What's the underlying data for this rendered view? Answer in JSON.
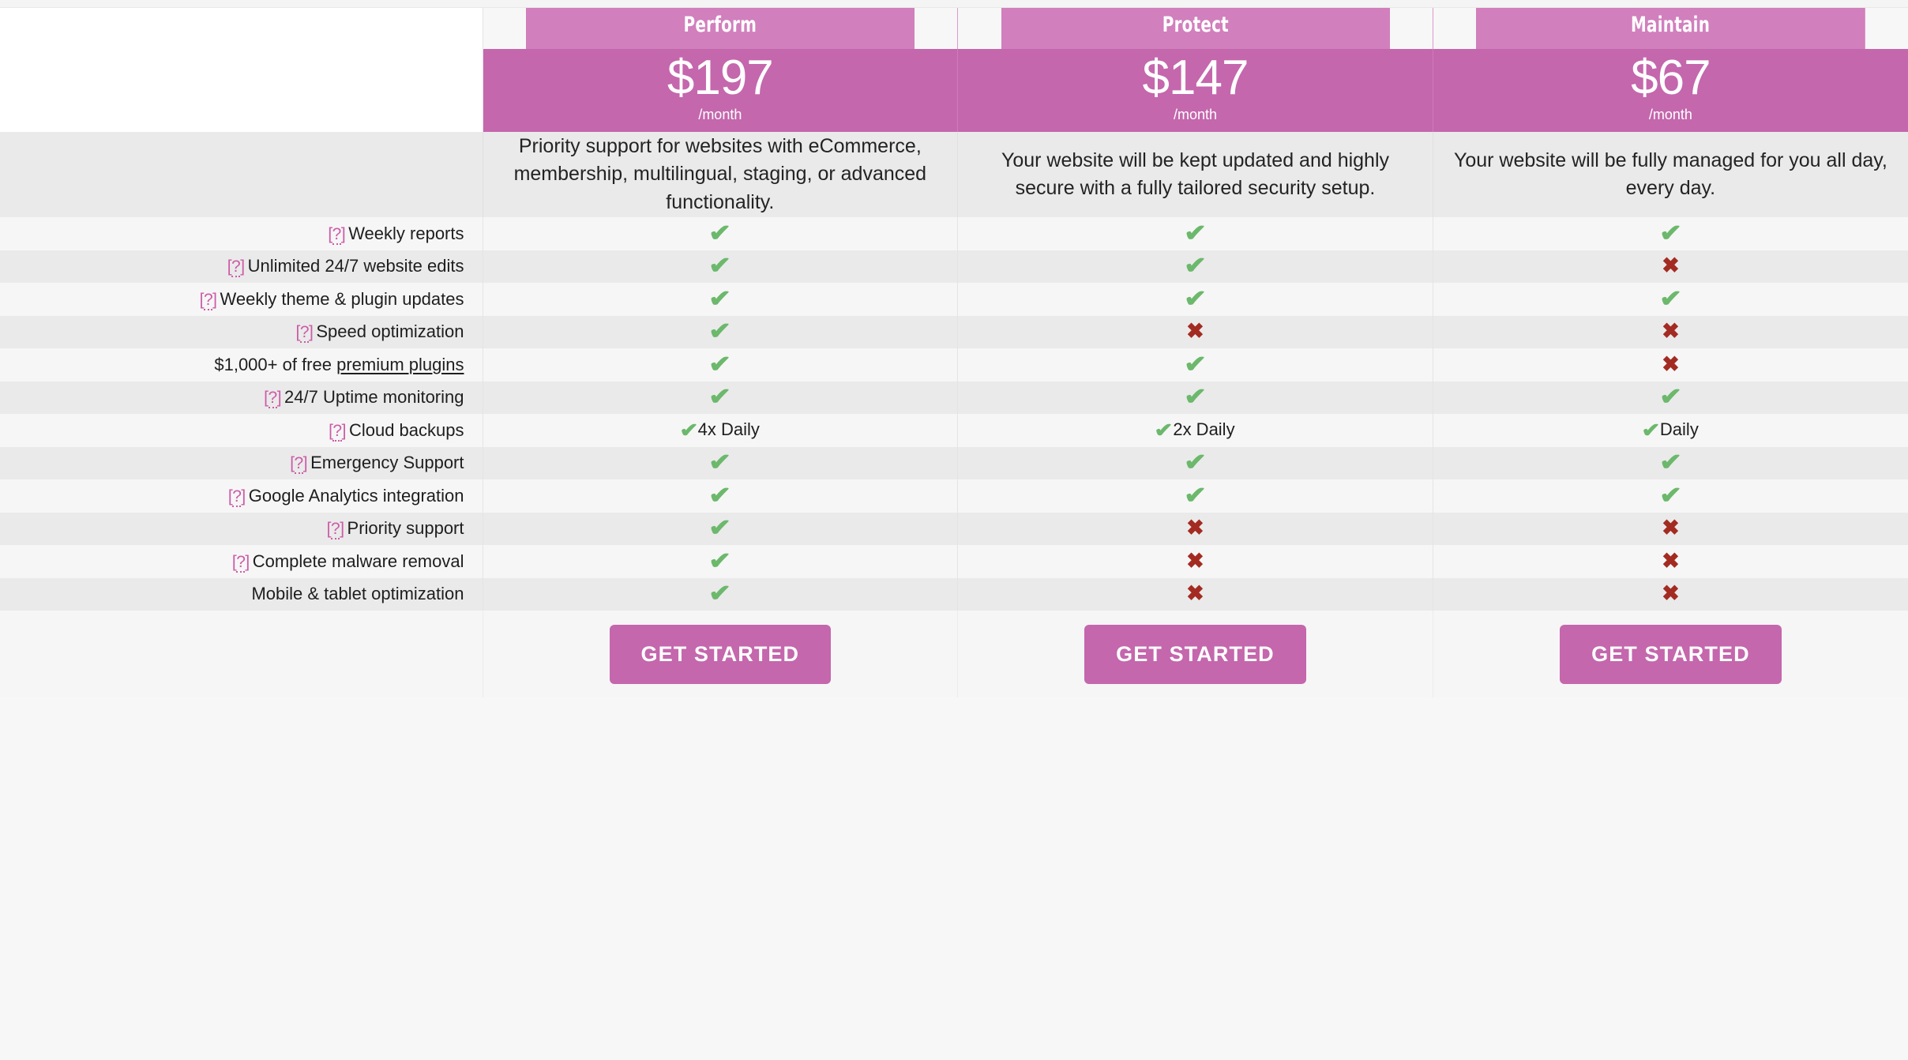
{
  "plans": [
    {
      "name": "Perform",
      "price": "$197",
      "period": "/month",
      "description": "Priority support for websites with eCommerce, membership, multilingual, staging, or advanced functionality.",
      "cta_label": "GET STARTED"
    },
    {
      "name": "Protect",
      "price": "$147",
      "period": "/month",
      "description": "Your website will be kept updated and highly secure with a fully tailored security setup.",
      "cta_label": "GET STARTED"
    },
    {
      "name": "Maintain",
      "price": "$67",
      "period": "/month",
      "description": "Your website will be fully managed for you all day, every day.",
      "cta_label": "GET STARTED"
    }
  ],
  "tooltip_glyph": "[?]",
  "check_glyph": "✔",
  "cross_glyph": "✖",
  "features": [
    {
      "label": "Weekly reports",
      "has_tooltip": true,
      "values": [
        {
          "type": "check"
        },
        {
          "type": "check"
        },
        {
          "type": "check"
        }
      ]
    },
    {
      "label": "Unlimited 24/7 website edits",
      "has_tooltip": true,
      "values": [
        {
          "type": "check"
        },
        {
          "type": "check"
        },
        {
          "type": "cross"
        }
      ]
    },
    {
      "label": "Weekly theme & plugin updates",
      "has_tooltip": true,
      "values": [
        {
          "type": "check"
        },
        {
          "type": "check"
        },
        {
          "type": "check"
        }
      ]
    },
    {
      "label": "Speed optimization",
      "has_tooltip": true,
      "values": [
        {
          "type": "check"
        },
        {
          "type": "cross"
        },
        {
          "type": "cross"
        }
      ]
    },
    {
      "label": "$1,000+ of free premium plugins",
      "has_tooltip": false,
      "link_text": "premium plugins",
      "prefix_text": "$1,000+ of free ",
      "values": [
        {
          "type": "check"
        },
        {
          "type": "check"
        },
        {
          "type": "cross"
        }
      ]
    },
    {
      "label": "24/7 Uptime monitoring",
      "has_tooltip": true,
      "values": [
        {
          "type": "check"
        },
        {
          "type": "check"
        },
        {
          "type": "check"
        }
      ]
    },
    {
      "label": "Cloud backups",
      "has_tooltip": true,
      "values": [
        {
          "type": "check_text",
          "text": "4x Daily"
        },
        {
          "type": "check_text",
          "text": "2x Daily"
        },
        {
          "type": "check_text",
          "text": "Daily"
        }
      ]
    },
    {
      "label": "Emergency Support",
      "has_tooltip": true,
      "values": [
        {
          "type": "check"
        },
        {
          "type": "check"
        },
        {
          "type": "check"
        }
      ]
    },
    {
      "label": "Google Analytics integration",
      "has_tooltip": true,
      "values": [
        {
          "type": "check"
        },
        {
          "type": "check"
        },
        {
          "type": "check"
        }
      ]
    },
    {
      "label": "Priority support",
      "has_tooltip": true,
      "values": [
        {
          "type": "check"
        },
        {
          "type": "cross"
        },
        {
          "type": "cross"
        }
      ]
    },
    {
      "label": "Complete malware removal",
      "has_tooltip": true,
      "values": [
        {
          "type": "check"
        },
        {
          "type": "cross"
        },
        {
          "type": "cross"
        }
      ]
    },
    {
      "label": "Mobile & tablet optimization",
      "has_tooltip": false,
      "values": [
        {
          "type": "check"
        },
        {
          "type": "cross"
        },
        {
          "type": "cross"
        }
      ]
    }
  ],
  "colors": {
    "plan_header": "#d17fbd",
    "price_header": "#c467ad",
    "cta_button": "#c467ad",
    "check_green": "#6cb86c",
    "cross_red": "#a32b21",
    "tooltip_pink": "#cc5ba7",
    "row_light": "#f6f6f6",
    "row_dark": "#eaeaea",
    "description_bg": "#eaeaea"
  }
}
